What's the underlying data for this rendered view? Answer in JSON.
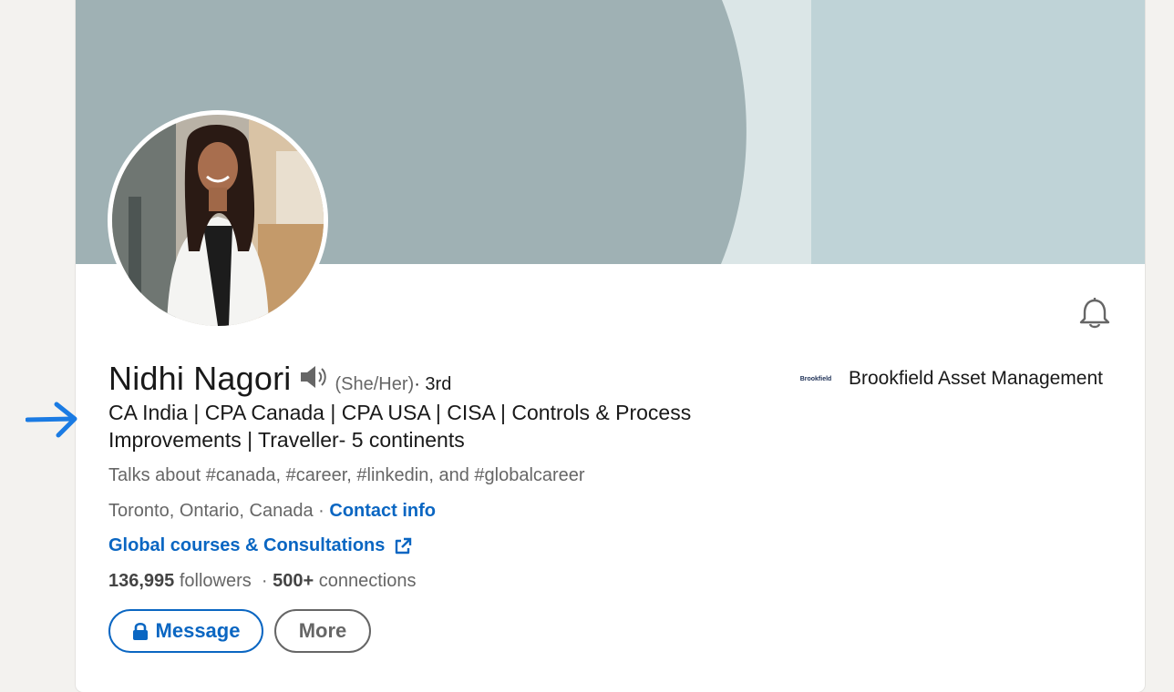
{
  "profile": {
    "name": "Nidhi Nagori",
    "pronouns": "(She/Her)",
    "degree": " · 3rd",
    "headline": "CA India | CPA Canada | CPA USA | CISA | Controls & Process Improvements | Traveller- 5 continents",
    "talks_about": "Talks about #canada, #career, #linkedin, and #globalcareer",
    "location": "Toronto, Ontario, Canada",
    "location_sep": " · ",
    "contact_info_label": "Contact info",
    "website_label": "Global courses & Consultations",
    "followers_count": "136,995",
    "followers_label": " followers",
    "connections_sep": "  · ",
    "connections_count": "500+",
    "connections_label": " connections"
  },
  "company": {
    "logo_text": "Brookfield",
    "name": "Brookfield Asset Management"
  },
  "actions": {
    "message_label": "Message",
    "more_label": "More"
  },
  "icons": {
    "bell": "bell-icon",
    "speaker": "speaker-icon",
    "external_link": "external-link-icon",
    "lock": "lock-icon",
    "arrow": "arrow-right-icon"
  },
  "colors": {
    "accent": "#0a66c2",
    "banner_dark": "#9fb1b4",
    "banner_mid": "#dbe6e7",
    "banner_light": "#bfd3d7",
    "annotation_arrow": "#1a7be3"
  }
}
